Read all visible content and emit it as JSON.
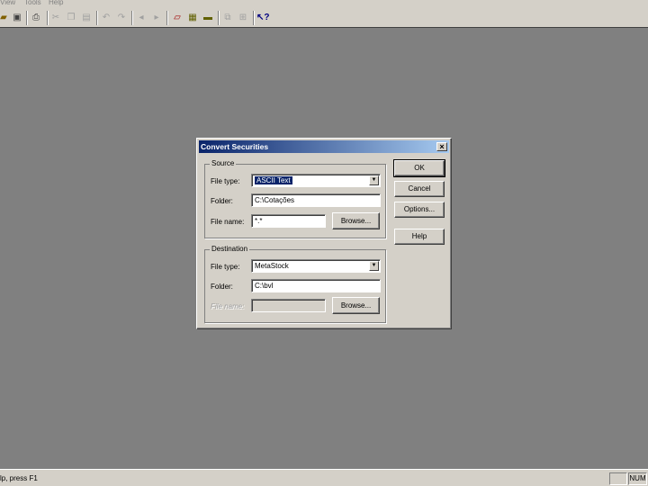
{
  "menubar": {
    "items": [
      "View",
      "Tools",
      "Help"
    ]
  },
  "toolbar": {
    "icons": [
      "open-icon",
      "save-icon",
      "print-icon",
      "cut-icon",
      "copy-icon",
      "paste-icon",
      "undo-icon",
      "redo-icon",
      "previous-icon",
      "next-icon",
      "eraser-icon",
      "convert-icon",
      "folder-icon",
      "window-icon",
      "grid-icon",
      "context-help-icon"
    ]
  },
  "statusbar": {
    "text": "lp, press F1",
    "num": "NUM"
  },
  "dialog": {
    "title": "Convert Securities",
    "source": {
      "legend": "Source",
      "file_type_label": "File type:",
      "file_type_value": "ASCII Text",
      "folder_label": "Folder:",
      "folder_value": "C:\\Cotações",
      "file_name_label": "File name:",
      "file_name_value": "*.*",
      "browse": "Browse..."
    },
    "destination": {
      "legend": "Destination",
      "file_type_label": "File type:",
      "file_type_value": "MetaStock",
      "folder_label": "Folder:",
      "folder_value": "C:\\bvl",
      "file_name_label": "File name:",
      "file_name_value": "",
      "browse": "Browse..."
    },
    "buttons": {
      "ok": "OK",
      "cancel": "Cancel",
      "options": "Options...",
      "help": "Help"
    }
  }
}
